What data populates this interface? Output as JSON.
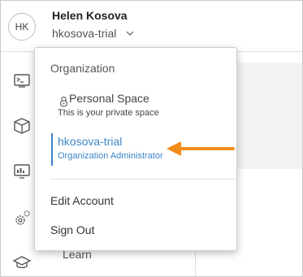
{
  "header": {
    "avatar_initials": "HK",
    "user_name": "Helen Kosova",
    "org_name": "hkosova-trial"
  },
  "sidebar": {
    "icons": [
      "terminal-icon",
      "box-icon",
      "monitor-chart-icon",
      "gears-icon",
      "graduation-cap-icon"
    ],
    "learn_label": "Learn"
  },
  "dropdown": {
    "heading": "Organization",
    "items": [
      {
        "title": "Personal Space",
        "subtitle": "This is your private space",
        "icon": "lock-icon",
        "active": false
      },
      {
        "title": "hkosova-trial",
        "subtitle": "Organization Administrator",
        "active": true
      }
    ],
    "actions": [
      "Edit Account",
      "Sign Out"
    ]
  },
  "colors": {
    "accent": "#3d85c6",
    "arrow": "#f28c1a"
  }
}
